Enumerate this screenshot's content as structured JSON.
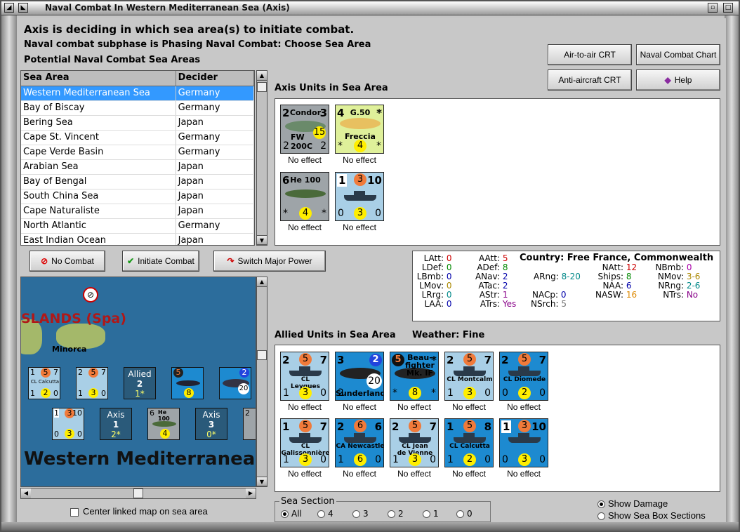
{
  "window": {
    "title": "Naval Combat In Western Mediterranean Sea (Axis)"
  },
  "header": {
    "line1": "Axis is deciding in which sea area(s) to initiate combat.",
    "line2": "Naval combat subphase is Phasing Naval Combat: Choose Sea Area",
    "line3": "Potential Naval Combat Sea Areas"
  },
  "table": {
    "col_area": "Sea Area",
    "col_decider": "Decider",
    "rows": [
      {
        "area": "Western Mediterranean Sea",
        "decider": "Germany"
      },
      {
        "area": "Bay of Biscay",
        "decider": "Germany"
      },
      {
        "area": "Bering Sea",
        "decider": "Japan"
      },
      {
        "area": "Cape St. Vincent",
        "decider": "Germany"
      },
      {
        "area": "Cape Verde Basin",
        "decider": "Germany"
      },
      {
        "area": "Arabian Sea",
        "decider": "Japan"
      },
      {
        "area": "Bay of Bengal",
        "decider": "Japan"
      },
      {
        "area": "South China Sea",
        "decider": "Japan"
      },
      {
        "area": "Cape Naturaliste",
        "decider": "Japan"
      },
      {
        "area": "North Atlantic",
        "decider": "Germany"
      },
      {
        "area": "East Indian Ocean",
        "decider": "Japan"
      }
    ]
  },
  "buttons": {
    "air_crt": "Air-to-air CRT",
    "naval_chart": "Naval Combat Chart",
    "aa_crt": "Anti-aircraft CRT",
    "help": "Help",
    "no_combat": "No Combat",
    "initiate": "Initiate Combat",
    "switch": "Switch Major Power"
  },
  "axis_units": {
    "label": "Axis Units in Sea Area",
    "units": [
      {
        "name": "Condor",
        "sub": "FW 200C",
        "tl": "2",
        "tr": "3",
        "bl": "2",
        "br": "2",
        "circle": "15",
        "effect": "No effect"
      },
      {
        "name": "G.50",
        "sub": "Freccia",
        "tl": "4",
        "tr": "*",
        "bl": "*",
        "br": "*",
        "circle": "4",
        "effect": "No effect"
      },
      {
        "name": "He 100",
        "sub": "",
        "tl": "6",
        "tr": "",
        "bl": "*",
        "br": "*",
        "circle": "4",
        "effect": "No effect"
      },
      {
        "name": "",
        "sub": "",
        "tl": "1",
        "tr": "10",
        "bl": "0",
        "br": "0",
        "circle": "3",
        "top_circle": "3",
        "effect": "No effect"
      }
    ]
  },
  "stats": {
    "latt_l": "LAtt:",
    "latt_v": "0",
    "ldef_l": "LDef:",
    "ldef_v": "0",
    "lbmb_l": "LBmb:",
    "lbmb_v": "0",
    "lmov_l": "LMov:",
    "lmov_v": "0",
    "lrrg_l": "LRrg:",
    "lrrg_v": "0",
    "laa_l": "LAA:",
    "laa_v": "0",
    "aatt_l": "AAtt:",
    "aatt_v": "5",
    "adef_l": "ADef:",
    "adef_v": "8",
    "anav_l": "ANav:",
    "anav_v": "2",
    "atac_l": "ATac:",
    "atac_v": "2",
    "astr_l": "AStr:",
    "astr_v": "1",
    "atrs_l": "ATrs:",
    "atrs_v": "Yes",
    "country": "Country: Free France, Commonwealth",
    "arng_l": "ARng:",
    "arng_v": "8-20",
    "nacp_l": "NACp:",
    "nacp_v": "0",
    "nsrch_l": "NSrch:",
    "nsrch_v": "5",
    "natt_l": "NAtt:",
    "natt_v": "12",
    "ships_l": "Ships:",
    "ships_v": "8",
    "naa_l": "NAA:",
    "naa_v": "6",
    "nasw_l": "NASW:",
    "nasw_v": "16",
    "nbmb_l": "NBmb:",
    "nbmb_v": "0",
    "nmov_l": "NMov:",
    "nmov_v": "3-6",
    "nrng_l": "NRng:",
    "nrng_v": "2-6",
    "ntrs_l": "NTrs:",
    "ntrs_v": "No"
  },
  "allied": {
    "label": "Allied Units in Sea Area",
    "weather": "Weather:  Fine",
    "units": [
      {
        "name": "CL\nLeygues",
        "tl": "2",
        "om": "5",
        "tr": "7",
        "bl": "1",
        "bm": "3",
        "br": "0",
        "effect": "No effect"
      },
      {
        "name": "Sunderland",
        "tl": "3",
        "om": "",
        "tr": "2",
        "bl": "2",
        "bm": "20",
        "br": "",
        "effect": "No effect"
      },
      {
        "name": "Beau-\nfighter\nMk. IF",
        "tl": "5",
        "om": "",
        "tr": "*",
        "bl": "*",
        "bm": "8",
        "br": "*",
        "effect": "No effect"
      },
      {
        "name": "CL Montcalm",
        "tl": "2",
        "om": "5",
        "tr": "7",
        "bl": "1",
        "bm": "3",
        "br": "0",
        "effect": "No effect"
      },
      {
        "name": "CL Diomede",
        "tl": "2",
        "om": "5",
        "tr": "7",
        "bl": "0",
        "bm": "2",
        "br": "0",
        "effect": "No effect"
      },
      {
        "name": "CL\nGalissonnière",
        "tl": "1",
        "om": "5",
        "tr": "7",
        "bl": "1",
        "bm": "3",
        "br": "0",
        "effect": "No effect"
      },
      {
        "name": "CA Newcastle",
        "tl": "2",
        "om": "6",
        "tr": "6",
        "bl": "1",
        "bm": "6",
        "br": "0",
        "effect": "No effect"
      },
      {
        "name": "CL Jean\nde Vienne",
        "tl": "2",
        "om": "5",
        "tr": "7",
        "bl": "1",
        "bm": "3",
        "br": "0",
        "effect": "No effect"
      },
      {
        "name": "CL Calcutta",
        "tl": "1",
        "om": "5",
        "tr": "8",
        "bl": "1",
        "bm": "2",
        "br": "0",
        "effect": "No effect"
      },
      {
        "name": "",
        "tl": "1",
        "om": "3",
        "tr": "10",
        "bl": "0",
        "bm": "3",
        "br": "0",
        "effect": "No effect"
      }
    ]
  },
  "map": {
    "region": "SLANDS (Spa)",
    "island": "Minorca",
    "area": "Western Mediterranea",
    "allied_box": {
      "label": "Allied",
      "n": "2",
      "s": "1*"
    },
    "axis_box1": {
      "label": "Axis",
      "n": "1",
      "s": "2*"
    },
    "axis_box2": {
      "label": "Axis",
      "n": "3",
      "s": "0*"
    }
  },
  "options": {
    "center_map": "Center linked map on sea area",
    "sea_section": "Sea Section",
    "sec_all": "All",
    "sec_4": "4",
    "sec_3": "3",
    "sec_2": "2",
    "sec_1": "1",
    "sec_0": "0",
    "show_damage": "Show Damage",
    "show_box": "Show Sea Box Sections"
  }
}
